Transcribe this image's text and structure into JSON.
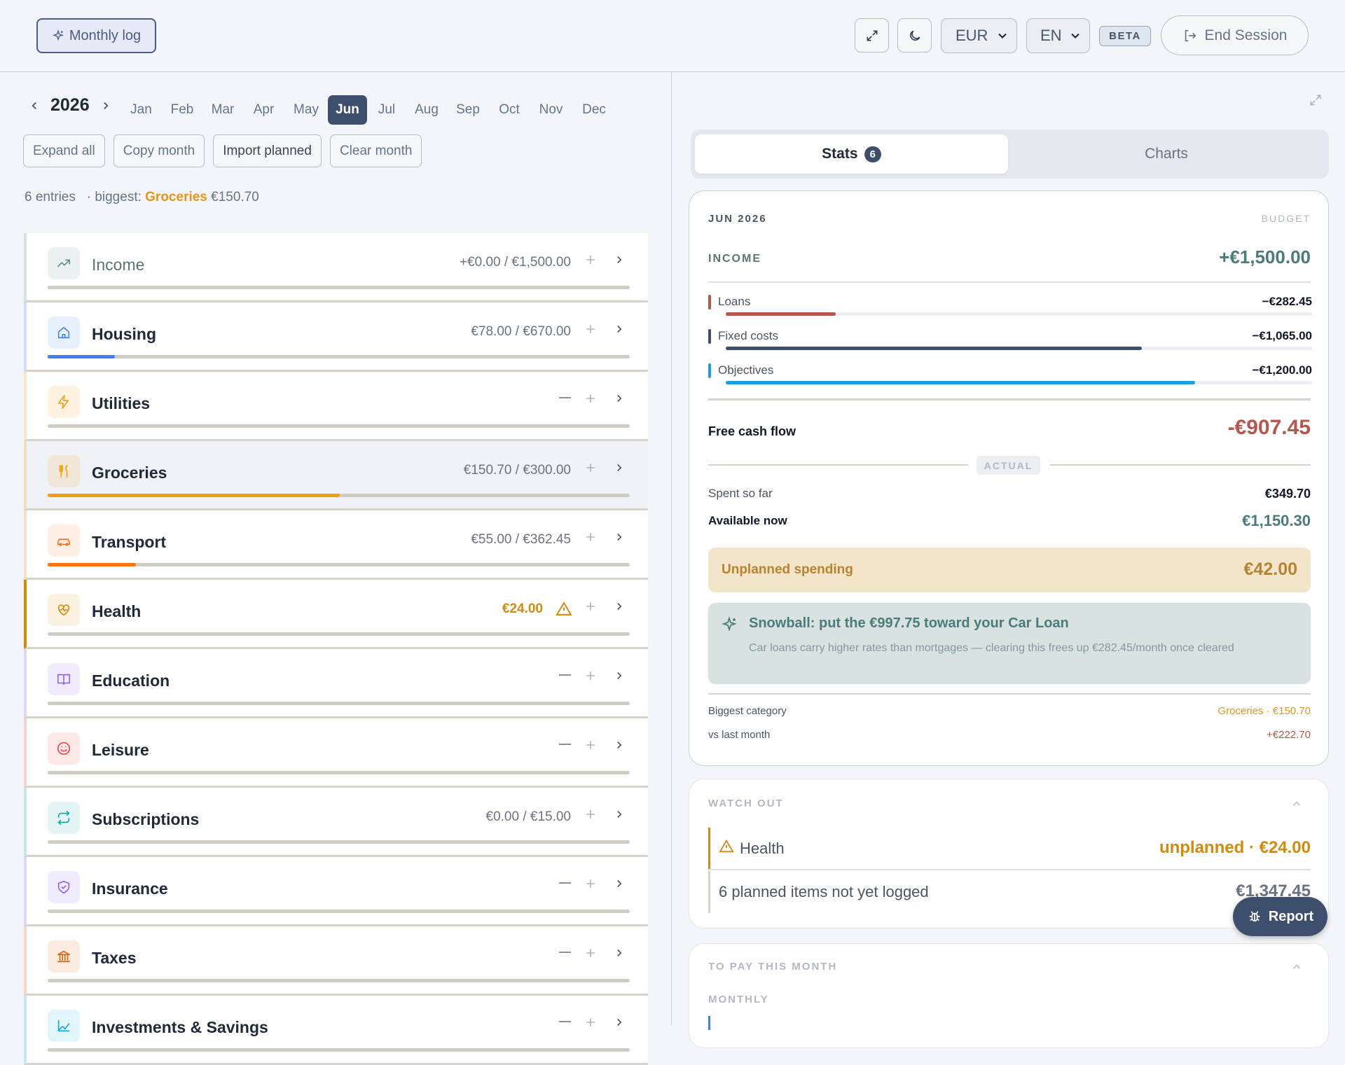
{
  "header": {
    "monthly_log_label": "Monthly log",
    "currency": "EUR",
    "language": "EN",
    "beta_label": "BETA",
    "end_session_label": "End Session"
  },
  "calendar": {
    "year": "2026",
    "months": [
      "Jan",
      "Feb",
      "Mar",
      "Apr",
      "May",
      "Jun",
      "Jul",
      "Aug",
      "Sep",
      "Oct",
      "Nov",
      "Dec"
    ],
    "active_month": "Jun"
  },
  "actions": {
    "expand_all": "Expand all",
    "copy_month": "Copy month",
    "import_planned": "Import planned",
    "clear_month": "Clear month"
  },
  "summary": {
    "entries": "6 entries",
    "biggest_prefix": "· biggest:",
    "biggest_name": "Groceries",
    "biggest_amount": "€150.70"
  },
  "categories": [
    {
      "name": "Income",
      "amount": "+€0.00 / €1,500.00",
      "icon": "trend-up-icon",
      "accent": "#5a8a84",
      "progress": 0.0
    },
    {
      "name": "Housing",
      "amount": "€78.00 / €670.00",
      "icon": "home-icon",
      "accent": "#3b82f6",
      "progress": 0.116
    },
    {
      "name": "Utilities",
      "amount": "",
      "icon": "bolt-icon",
      "accent": "#f59e0b",
      "progress": 0.0
    },
    {
      "name": "Groceries",
      "amount": "€150.70 / €300.00",
      "icon": "utensils-icon",
      "accent": "#f59e0b",
      "progress": 0.502
    },
    {
      "name": "Transport",
      "amount": "€55.00 / €362.45",
      "icon": "car-icon",
      "accent": "#f97316",
      "progress": 0.152
    },
    {
      "name": "Health",
      "amount": "€24.00",
      "icon": "heart-pulse-icon",
      "accent": "#d48a0a",
      "progress": 0.0
    },
    {
      "name": "Education",
      "amount": "",
      "icon": "book-icon",
      "accent": "#8b5cf6",
      "progress": 0.0
    },
    {
      "name": "Leisure",
      "amount": "",
      "icon": "smile-icon",
      "accent": "#ef4444",
      "progress": 0.0
    },
    {
      "name": "Subscriptions",
      "amount": "€0.00 / €15.00",
      "icon": "repeat-icon",
      "accent": "#0ea5a4",
      "progress": 0.0
    },
    {
      "name": "Insurance",
      "amount": "",
      "icon": "shield-icon",
      "accent": "#8b5cf6",
      "progress": 0.0
    },
    {
      "name": "Taxes",
      "amount": "",
      "icon": "bank-icon",
      "accent": "#ea580c",
      "progress": 0.0
    },
    {
      "name": "Investments & Savings",
      "amount": "",
      "icon": "chart-icon",
      "accent": "#0ea5e9",
      "progress": 0.0
    }
  ],
  "tabs": {
    "stats": "Stats",
    "stats_count": "6",
    "charts": "Charts"
  },
  "stats": {
    "period": "JUN 2026",
    "budget_label": "BUDGET",
    "income_label": "INCOME",
    "income_value": "+€1,500.00",
    "lines": [
      {
        "name": "Loans",
        "value": "−€282.45",
        "color": "#b5574b",
        "progress": 0.188
      },
      {
        "name": "Fixed costs",
        "value": "−€1,065.00",
        "color": "#3d4f6c",
        "progress": 0.71
      },
      {
        "name": "Objectives",
        "value": "−€1,200.00",
        "color": "#1aa0e0",
        "progress": 0.8
      }
    ],
    "free_cash_flow_label": "Free cash flow",
    "free_cash_flow_value": "-€907.45",
    "actual_label": "ACTUAL",
    "spent_label": "Spent so far",
    "spent_value": "€349.70",
    "available_label": "Available now",
    "available_value": "€1,150.30",
    "unplanned_label": "Unplanned spending",
    "unplanned_value": "€42.00",
    "snowball_title": "Snowball: put the €997.75 toward your Car Loan",
    "snowball_text": "Car loans carry higher rates than mortgages — clearing this frees up €282.45/month once cleared",
    "biggest_label": "Biggest category",
    "biggest_value": "Groceries · €150.70",
    "vs_label": "vs last month",
    "vs_value": "+€222.70"
  },
  "watch": {
    "title": "WATCH OUT",
    "item1_name": "Health",
    "item1_value": "unplanned · €24.00",
    "item2_name": "6 planned items not yet logged",
    "item2_value": "€1,347.45"
  },
  "pay": {
    "title": "TO PAY THIS MONTH",
    "sub": "MONTHLY"
  },
  "report_label": "Report"
}
